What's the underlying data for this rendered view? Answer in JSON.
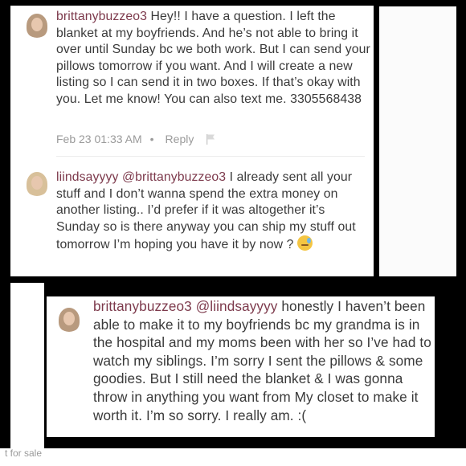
{
  "comments": [
    {
      "username": "brittanybuzzeo3",
      "text": " Hey!! I have a question. I left the blanket at my boyfriends. And he’s not able to bring it over until Sunday bc we both work. But I can send your pillows tomorrow if you want. And I will create a new listing so I can send it in two boxes. If that’s okay with you. Let me know!  You can also text me. 3305568438",
      "timestamp": "Feb 23 01:33 AM",
      "separator": "•",
      "reply_label": "Reply",
      "flag_icon": "flag-icon"
    },
    {
      "username": "liindsayyyy",
      "mention": "@brittanybuzzeo3",
      "text": " I already sent all your stuff and I don’t wanna spend the extra money on another listing.. I’d prefer if it was altogether it’s Sunday so is there anyway you can ship my stuff out tomorrow I’m hoping you have it by now ? ",
      "emoji": "downcast-sweat-face-emoji"
    },
    {
      "username": "brittanybuzzeo3",
      "mention": "@liindsayyyy",
      "text": " honestly I haven’t been able to make it to my boyfriends bc my grandma is in the hospital and my moms been with her so I’ve had to watch my siblings. I’m sorry I sent the pillows & some goodies. But I still need the blanket & I was gonna throw in anything you want from My closet to make it worth it. I’m so sorry. I really am. :("
    }
  ],
  "footer_fragment": "t for sale",
  "colors": {
    "username": "#7d3a4c",
    "body": "#3a3a3a",
    "meta": "#9a9a9a",
    "background": "#000000"
  }
}
